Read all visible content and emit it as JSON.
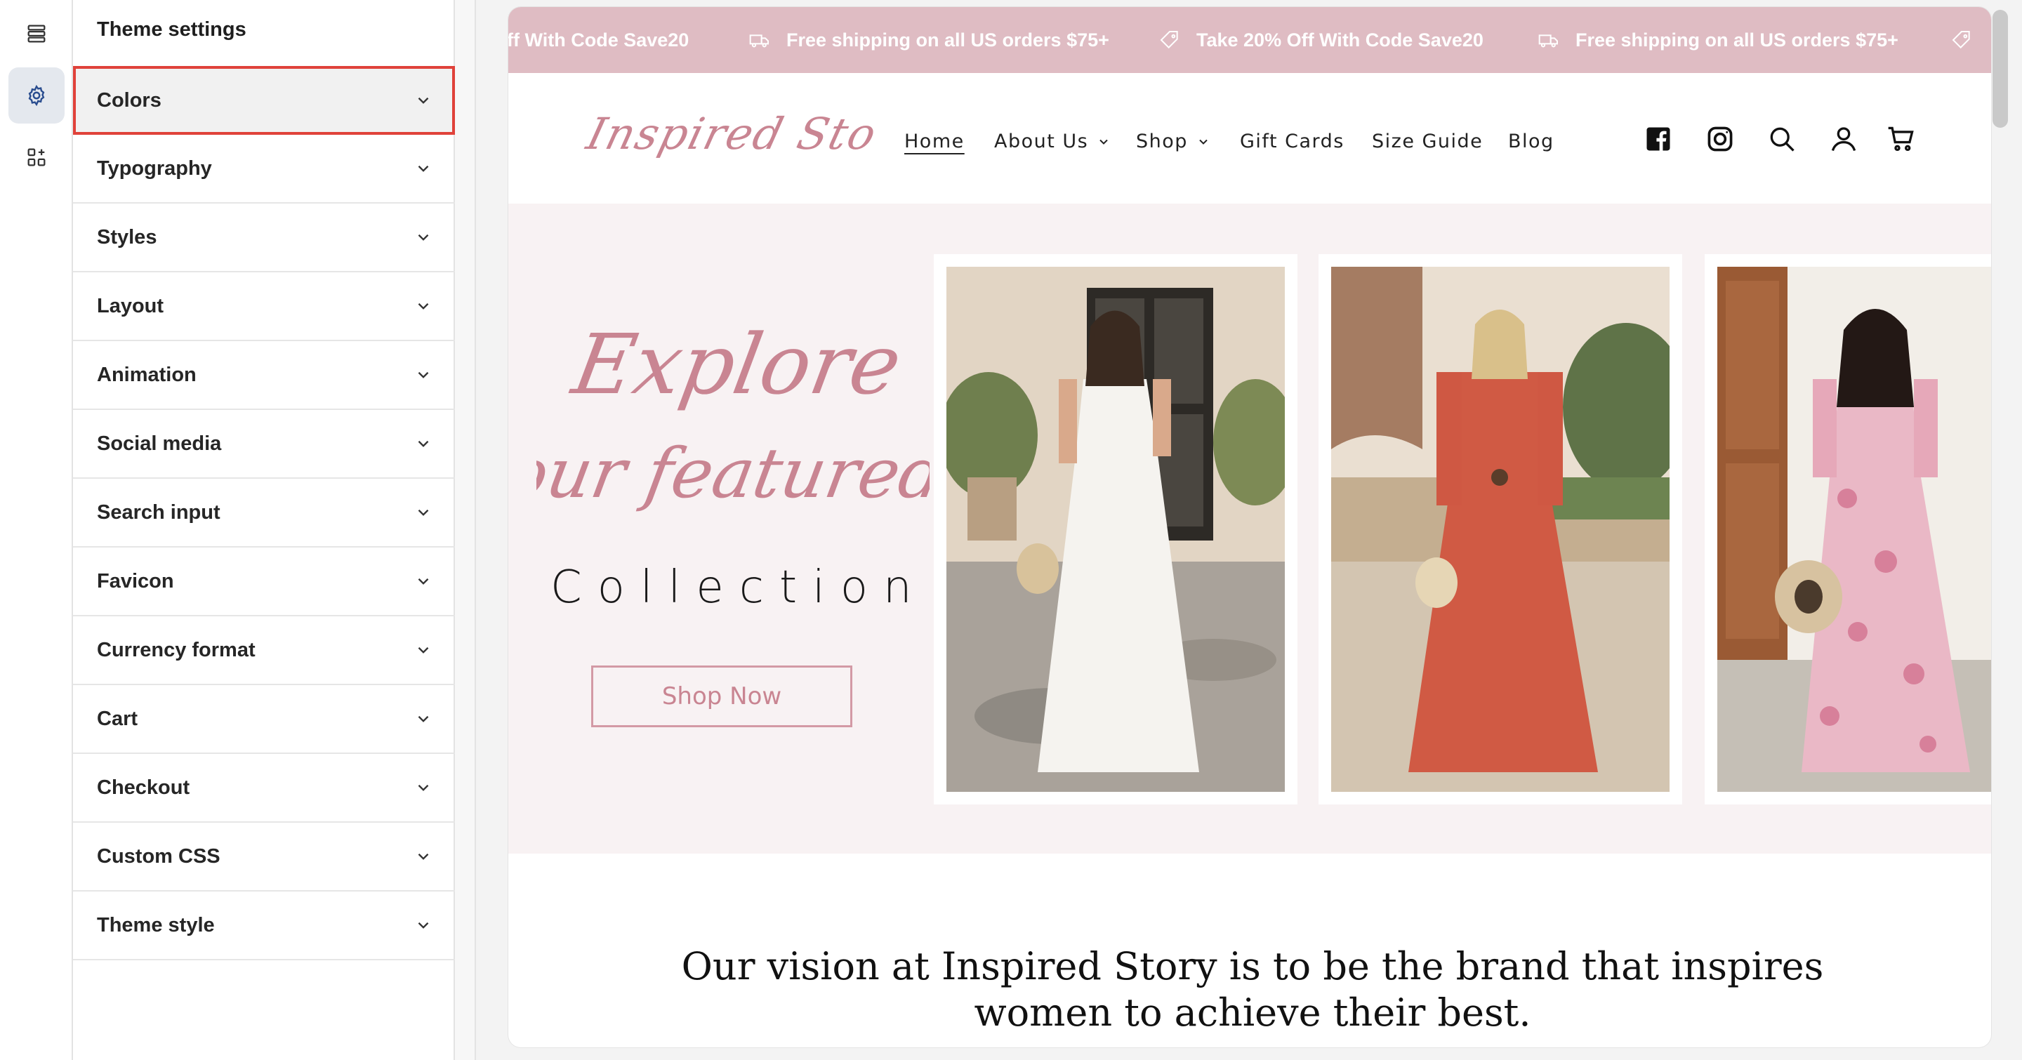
{
  "sidebar_rail": {
    "icons": [
      "sections-icon",
      "theme-settings-icon",
      "app-blocks-icon"
    ]
  },
  "panel": {
    "title": "Theme settings",
    "items": [
      {
        "label": "Colors"
      },
      {
        "label": "Typography"
      },
      {
        "label": "Styles"
      },
      {
        "label": "Layout"
      },
      {
        "label": "Animation"
      },
      {
        "label": "Social media"
      },
      {
        "label": "Search input"
      },
      {
        "label": "Favicon"
      },
      {
        "label": "Currency format"
      },
      {
        "label": "Cart"
      },
      {
        "label": "Checkout"
      },
      {
        "label": "Custom CSS"
      },
      {
        "label": "Theme style"
      }
    ]
  },
  "announcement": {
    "messages": [
      "ff With Code Save20",
      "Free shipping on all US orders $75+",
      "Take 20% Off With Code Save20",
      "Free shipping on all US orders $75+"
    ]
  },
  "header": {
    "logo_text": "Inspired Story",
    "nav": [
      {
        "label": "Home"
      },
      {
        "label": "About Us"
      },
      {
        "label": "Shop"
      },
      {
        "label": "Gift Cards"
      },
      {
        "label": "Size Guide"
      },
      {
        "label": "Blog"
      }
    ]
  },
  "hero": {
    "script_line1": "Explore",
    "script_line2": "our featured",
    "collection": "Collection",
    "cta": "Shop Now"
  },
  "vision": {
    "line1": "Our vision at Inspired Story is to be the brand that inspires",
    "line2": "women to achieve their best."
  },
  "colors": {
    "announcement_bg": "#dfbcc3",
    "hero_bg": "#f8f2f3",
    "accent_pink": "#c98592",
    "selection_outline": "#e0423a"
  }
}
